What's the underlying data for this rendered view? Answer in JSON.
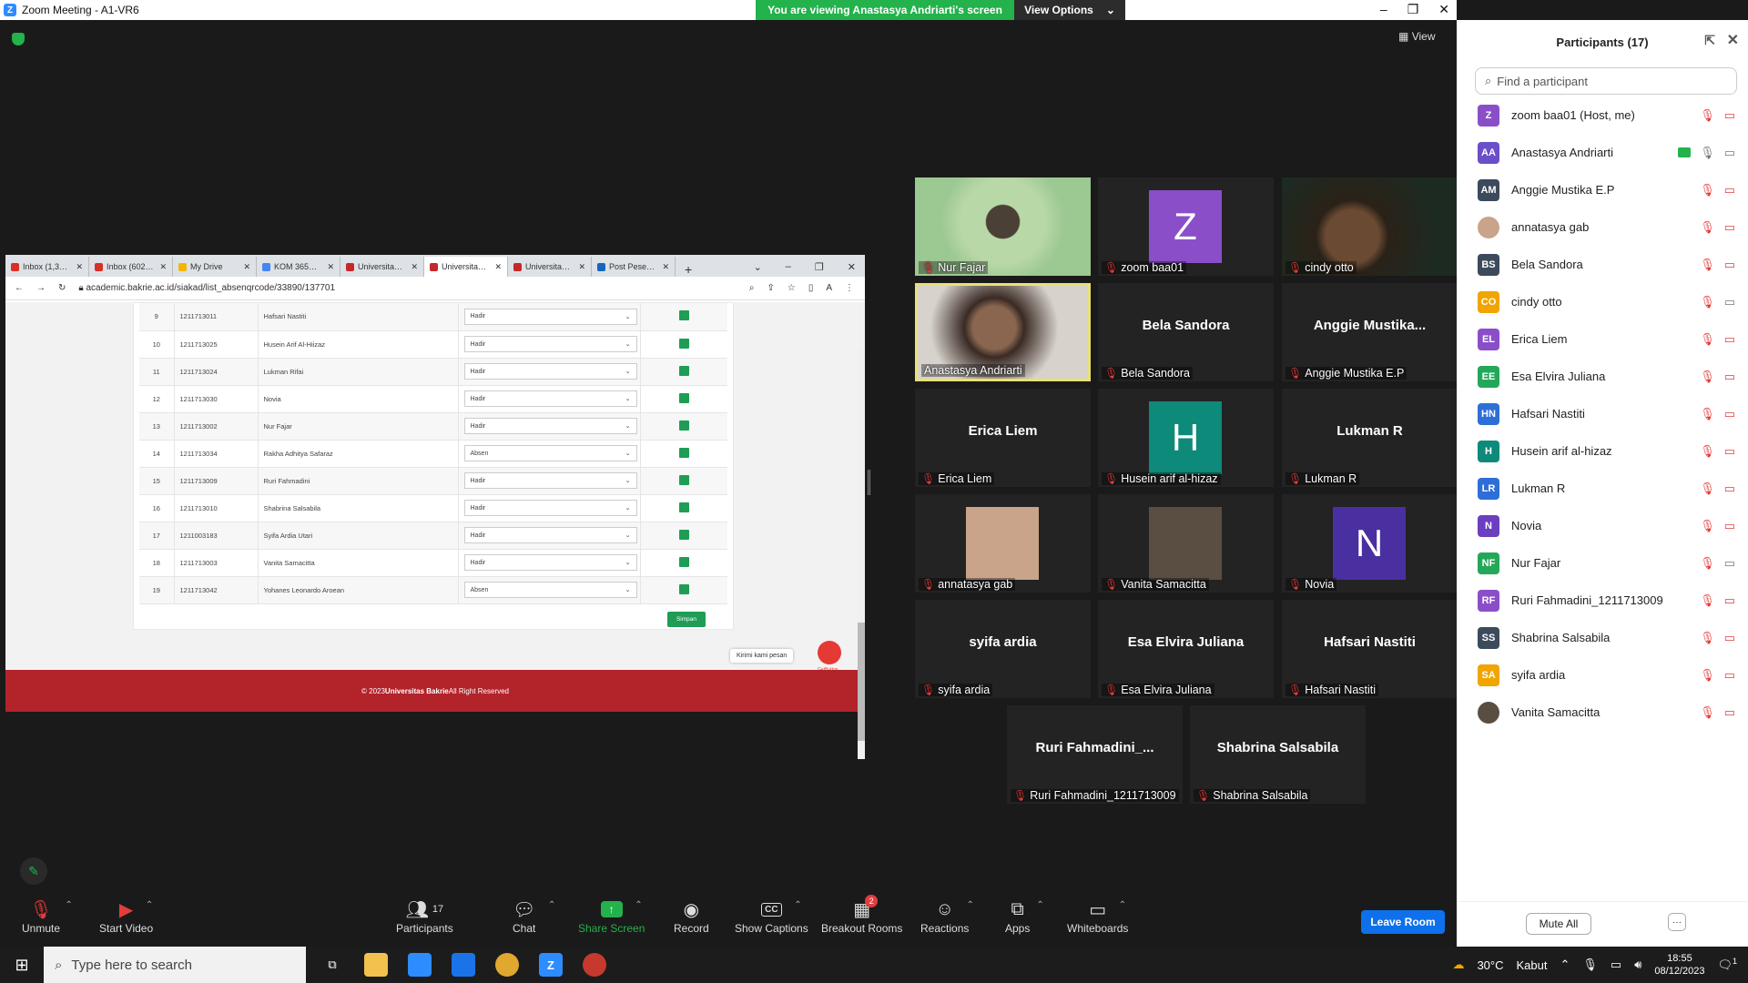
{
  "window": {
    "title": "Zoom Meeting - A1-VR6",
    "share_banner": "You are viewing Anastasya Andriarti's screen",
    "view_options": "View Options",
    "view_button": "View"
  },
  "browser": {
    "tabs": [
      {
        "label": "Inbox (1,3…",
        "color": "#d93025"
      },
      {
        "label": "Inbox (602…",
        "color": "#d93025"
      },
      {
        "label": "My Drive",
        "color": "#f4b400"
      },
      {
        "label": "KOM 365…",
        "color": "#4285f4"
      },
      {
        "label": "Universita…",
        "color": "#c62828"
      },
      {
        "label": "Universita…",
        "color": "#c62828"
      },
      {
        "label": "Universita…",
        "color": "#c62828"
      },
      {
        "label": "Post Pese…",
        "color": "#1565c0"
      }
    ],
    "url": "academic.bakrie.ac.id/siakad/list_absenqrcode/33890/137701",
    "profile_initial": "A",
    "rows": [
      {
        "no": "9",
        "nim": "1211713011",
        "name": "Hafsari Nastiti",
        "status": "Hadir"
      },
      {
        "no": "10",
        "nim": "1211713025",
        "name": "Husein Arif Al-Hiizaz",
        "status": "Hadir"
      },
      {
        "no": "11",
        "nim": "1211713024",
        "name": "Lukman Rifai",
        "status": "Hadir"
      },
      {
        "no": "12",
        "nim": "1211713030",
        "name": "Novia",
        "status": "Hadir"
      },
      {
        "no": "13",
        "nim": "1211713002",
        "name": "Nur Fajar",
        "status": "Hadir"
      },
      {
        "no": "14",
        "nim": "1211713034",
        "name": "Rakha Adhitya Safaraz",
        "status": "Absen"
      },
      {
        "no": "15",
        "nim": "1211713009",
        "name": "Ruri Fahmadini",
        "status": "Hadir"
      },
      {
        "no": "16",
        "nim": "1211713010",
        "name": "Shabrina Salsabila",
        "status": "Hadir"
      },
      {
        "no": "17",
        "nim": "1211003183",
        "name": "Syifa Ardia Utari",
        "status": "Hadir"
      },
      {
        "no": "18",
        "nim": "1211713003",
        "name": "Vanita Samacitta",
        "status": "Hadir"
      },
      {
        "no": "19",
        "nim": "1211713042",
        "name": "Yohanes Leonardo Aroean",
        "status": "Absen"
      }
    ],
    "save_label": "Simpan",
    "footer_prefix": "© 2023 ",
    "footer_brand": "Universitas Bakrie",
    "footer_suffix": " All Right Reserved",
    "chat_label": "Kirimi kami pesan",
    "getbutton": "GetButton"
  },
  "gallery": [
    {
      "type": "video",
      "style": "vid-green",
      "label": "Nur Fajar"
    },
    {
      "type": "avatar",
      "initial": "Z",
      "color": "#8a4fc8",
      "label": "zoom baa01"
    },
    {
      "type": "video",
      "style": "vid-dark",
      "label": "cindy otto"
    },
    {
      "type": "video",
      "style": "vid-woman",
      "label": "Anastasya Andriarti",
      "active": true
    },
    {
      "type": "name",
      "big": "Bela Sandora",
      "label": "Bela Sandora"
    },
    {
      "type": "name",
      "big": "Anggie  Mustika...",
      "label": "Anggie Mustika E.P"
    },
    {
      "type": "name",
      "big": "Erica Liem",
      "label": "Erica Liem"
    },
    {
      "type": "avatar",
      "initial": "H",
      "color": "#0d8a7a",
      "label": "Husein arif al-hizaz"
    },
    {
      "type": "name",
      "big": "Lukman R",
      "label": "Lukman R"
    },
    {
      "type": "photo",
      "color": "#c9a48a",
      "label": "annatasya gab"
    },
    {
      "type": "photo",
      "color": "#5a4e42",
      "label": "Vanita Samacitta"
    },
    {
      "type": "avatar",
      "initial": "N",
      "color": "#4a2fa0",
      "label": "Novia"
    },
    {
      "type": "name",
      "big": "syifa ardia",
      "label": "syifa ardia"
    },
    {
      "type": "name",
      "big": "Esa Elvira Juliana",
      "label": "Esa Elvira Juliana"
    },
    {
      "type": "name",
      "big": "Hafsari Nastiti",
      "label": "Hafsari Nastiti"
    },
    {
      "type": "name",
      "big": "Ruri  Fahmadini_...",
      "label": "Ruri Fahmadini_1211713009"
    },
    {
      "type": "name",
      "big": "Shabrina Salsabila",
      "label": "Shabrina Salsabila"
    }
  ],
  "participants_panel": {
    "title": "Participants (17)",
    "search_placeholder": "Find a participant",
    "list": [
      {
        "initials": "Z",
        "color": "#8a4fc8",
        "name": "zoom baa01 (Host, me)",
        "mic": "off",
        "video": "off"
      },
      {
        "initials": "AA",
        "color": "#6a4fc8",
        "name": "Anastasya Andriarti",
        "mic": "on",
        "video": "on",
        "sharing": true
      },
      {
        "initials": "AM",
        "color": "#3d4a5c",
        "name": "Anggie Mustika E.P",
        "mic": "off",
        "video": "off"
      },
      {
        "initials": "",
        "color": "#c9a48a",
        "name": "annatasya gab",
        "mic": "off",
        "video": "off",
        "photo": true
      },
      {
        "initials": "BS",
        "color": "#3d4a5c",
        "name": "Bela Sandora",
        "mic": "off",
        "video": "off"
      },
      {
        "initials": "CO",
        "color": "#f0a500",
        "name": "cindy otto",
        "mic": "off",
        "video": "on"
      },
      {
        "initials": "EL",
        "color": "#8a4fc8",
        "name": "Erica Liem",
        "mic": "off",
        "video": "off"
      },
      {
        "initials": "EE",
        "color": "#23a85a",
        "name": "Esa Elvira Juliana",
        "mic": "off",
        "video": "off"
      },
      {
        "initials": "HN",
        "color": "#2d6fd6",
        "name": "Hafsari Nastiti",
        "mic": "off",
        "video": "off"
      },
      {
        "initials": "H",
        "color": "#0d8a7a",
        "name": "Husein arif al-hizaz",
        "mic": "off",
        "video": "off"
      },
      {
        "initials": "LR",
        "color": "#2d6fd6",
        "name": "Lukman R",
        "mic": "off",
        "video": "off"
      },
      {
        "initials": "N",
        "color": "#6a3fc0",
        "name": "Novia",
        "mic": "off",
        "video": "off"
      },
      {
        "initials": "NF",
        "color": "#23a85a",
        "name": "Nur Fajar",
        "mic": "off",
        "video": "on"
      },
      {
        "initials": "RF",
        "color": "#8a4fc8",
        "name": "Ruri Fahmadini_1211713009",
        "mic": "off",
        "video": "off"
      },
      {
        "initials": "SS",
        "color": "#3d4a5c",
        "name": "Shabrina Salsabila",
        "mic": "off",
        "video": "off"
      },
      {
        "initials": "SA",
        "color": "#f0a500",
        "name": "syifa ardia",
        "mic": "off",
        "video": "off"
      },
      {
        "initials": "",
        "color": "#5a4e42",
        "name": "Vanita Samacitta",
        "mic": "off",
        "video": "off",
        "photo": true
      }
    ],
    "mute_all": "Mute All",
    "more": "···"
  },
  "toolbar": {
    "unmute": "Unmute",
    "start_video": "Start Video",
    "participants": "Participants",
    "participants_count": "17",
    "chat": "Chat",
    "share_screen": "Share Screen",
    "record": "Record",
    "show_captions": "Show Captions",
    "cc": "CC",
    "breakout_rooms": "Breakout Rooms",
    "breakout_badge": "2",
    "reactions": "Reactions",
    "apps": "Apps",
    "whiteboards": "Whiteboards",
    "leave_room": "Leave Room"
  },
  "taskbar": {
    "search_placeholder": "Type here to search",
    "temperature": "30°C",
    "weather": "Kabut",
    "time": "18:55",
    "date": "08/12/2023",
    "notification_count": "1"
  }
}
